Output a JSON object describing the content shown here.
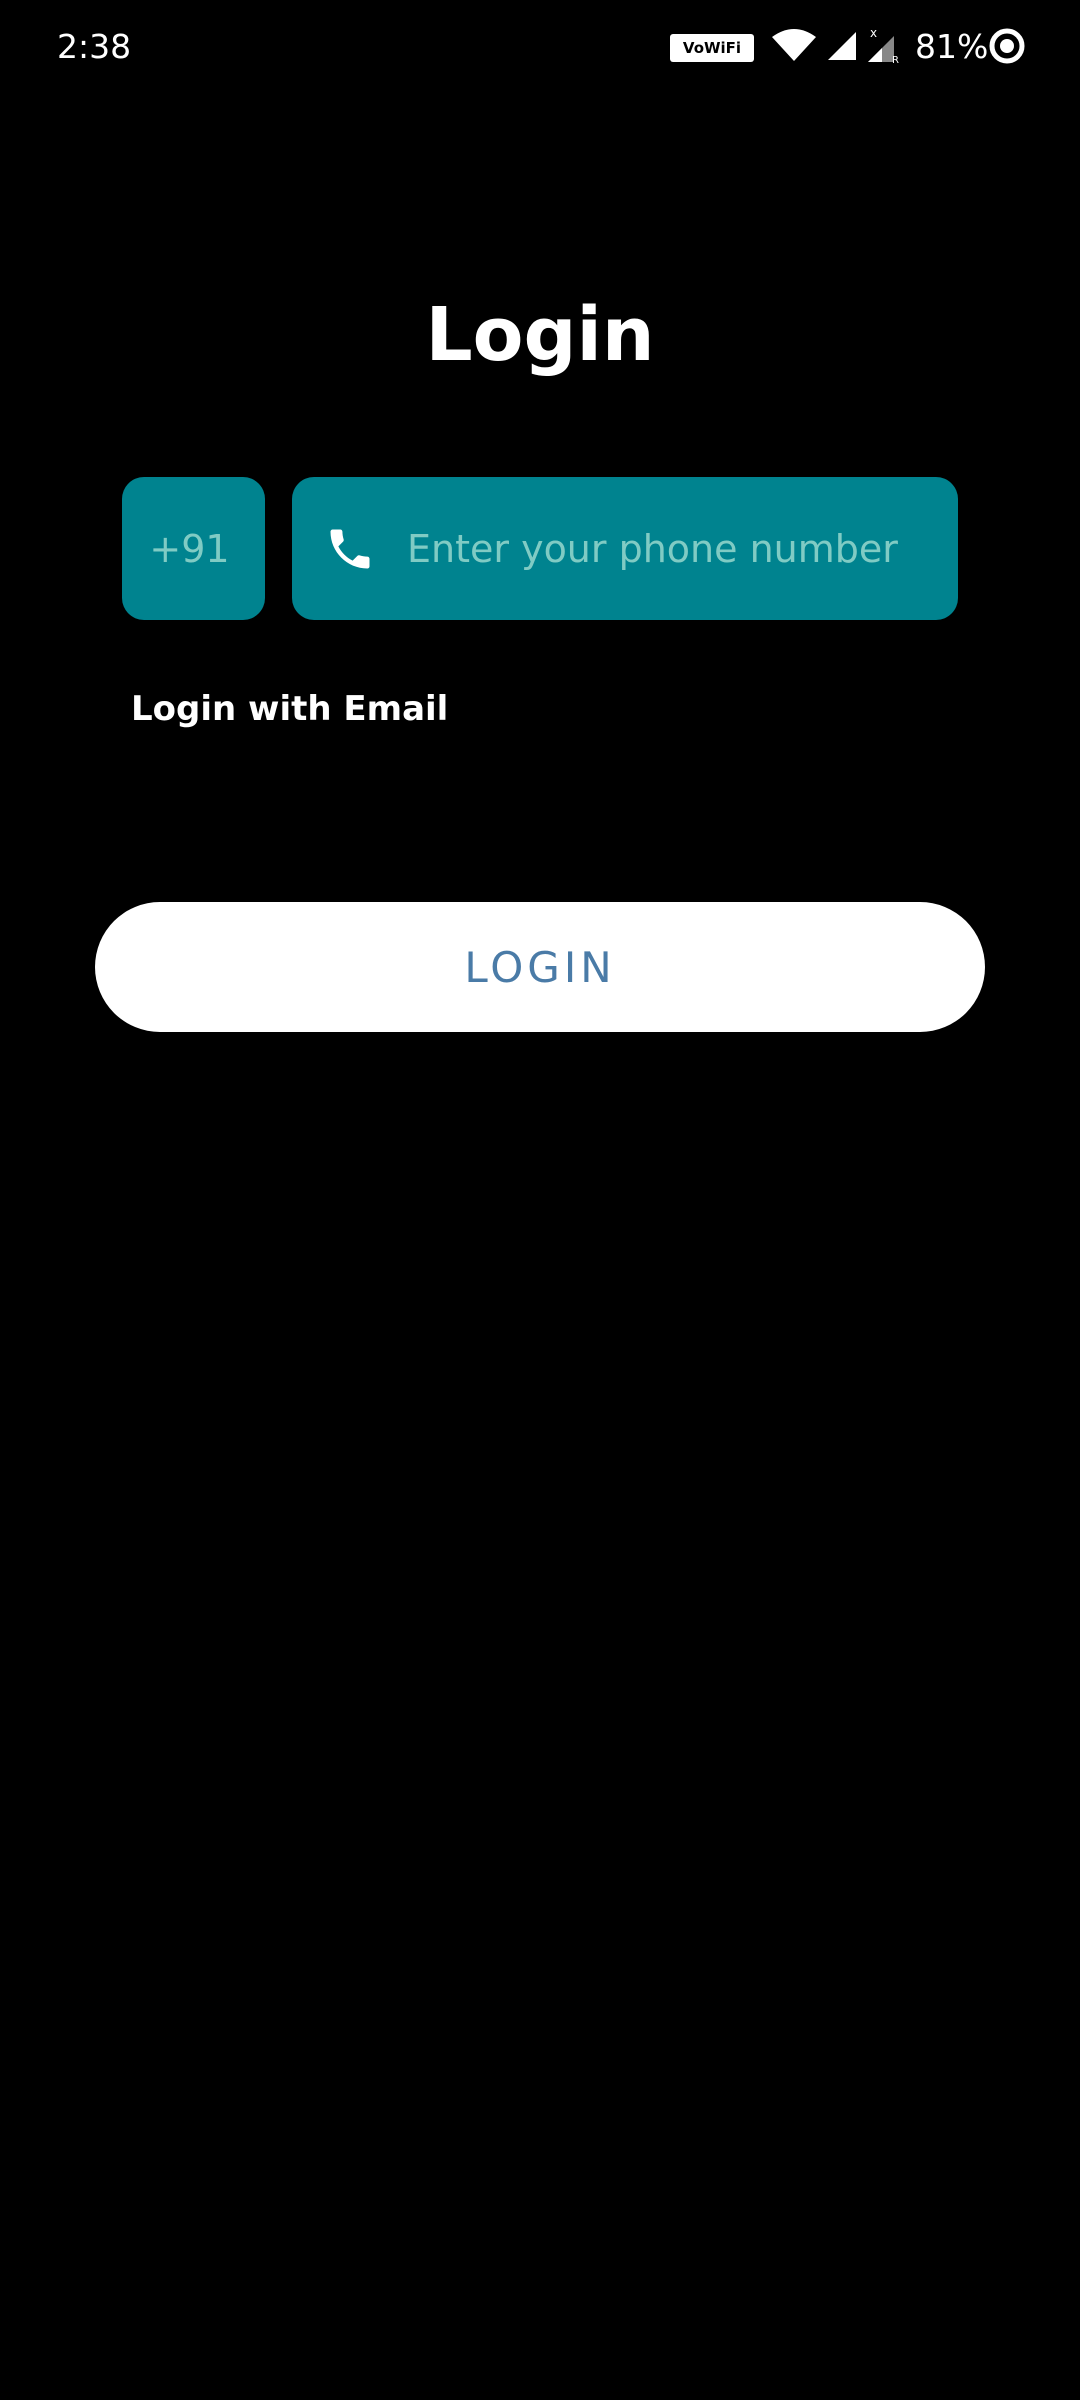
{
  "status_bar": {
    "time": "2:38",
    "vowifi_label": "VoWiFi",
    "battery_percent": "81%",
    "icons": [
      "wifi-icon",
      "signal-icon",
      "signal-no-service-icon",
      "battery-icon"
    ]
  },
  "login": {
    "title": "Login",
    "country_code": "+91",
    "phone_placeholder": "Enter your phone number",
    "phone_icon": "phone-icon",
    "email_link": "Login with Email",
    "login_button": "LOGIN"
  },
  "colors": {
    "background": "#000000",
    "field_fill": "#00838f",
    "field_hint_text": "#80cbc4",
    "button_fill": "#ffffff",
    "button_text": "#4a7ba7"
  }
}
